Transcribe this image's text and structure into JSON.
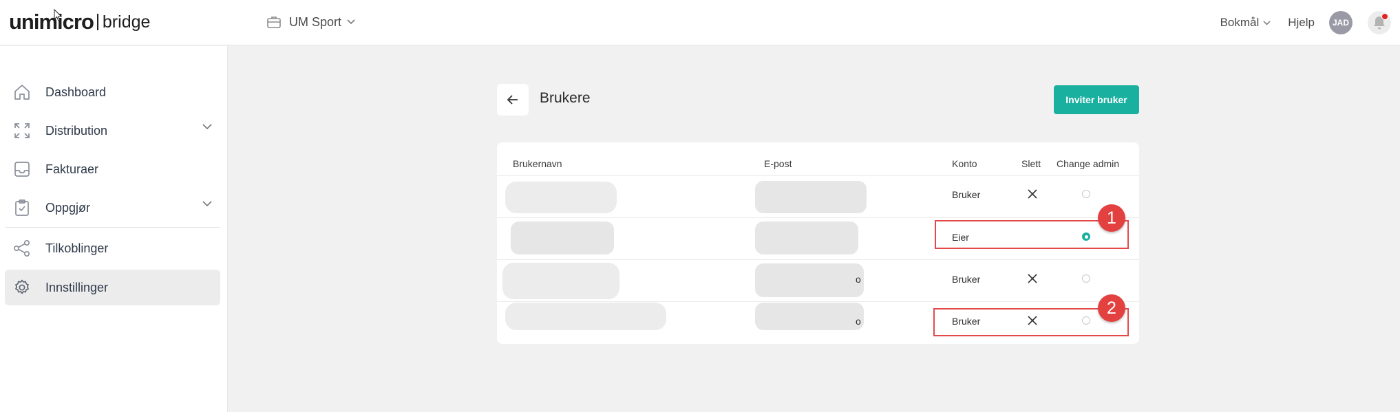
{
  "header": {
    "logo_main": "unimicro",
    "logo_sub": "bridge",
    "company": "UM Sport",
    "language": "Bokmål",
    "help": "Hjelp",
    "avatar_initials": "JAD"
  },
  "sidebar": {
    "items": [
      {
        "label": "Dashboard",
        "icon": "home-icon"
      },
      {
        "label": "Distribution",
        "icon": "expand-icon",
        "has_chevron": true
      },
      {
        "label": "Fakturaer",
        "icon": "inbox-icon"
      },
      {
        "label": "Oppgjør",
        "icon": "clipboard-check-icon",
        "has_chevron": true
      },
      {
        "label": "Tilkoblinger",
        "icon": "share-icon"
      },
      {
        "label": "Innstillinger",
        "icon": "gear-icon",
        "active": true
      }
    ]
  },
  "page": {
    "title": "Brukere",
    "invite_button": "Inviter bruker"
  },
  "table": {
    "headers": {
      "username": "Brukernavn",
      "email": "E-post",
      "account": "Konto",
      "delete": "Slett",
      "change_admin": "Change admin"
    },
    "rows": [
      {
        "account": "Bruker",
        "deletable": true,
        "admin_selected": false,
        "email_suffix": ""
      },
      {
        "account": "Eier",
        "deletable": false,
        "admin_selected": true,
        "email_suffix": ""
      },
      {
        "account": "Bruker",
        "deletable": true,
        "admin_selected": false,
        "email_suffix": "o"
      },
      {
        "account": "Bruker",
        "deletable": true,
        "admin_selected": false,
        "email_suffix": "o"
      }
    ]
  },
  "annotations": [
    "1",
    "2"
  ],
  "colors": {
    "accent": "#1ab0a0",
    "highlight": "#e24a4a",
    "notification_dot": "#e02424"
  }
}
